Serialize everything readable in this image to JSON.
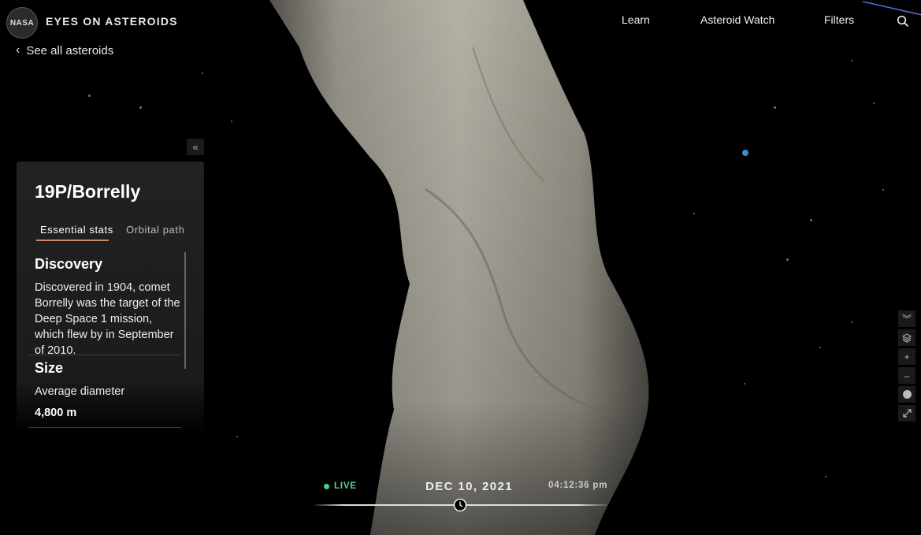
{
  "header": {
    "logo_text": "NASA",
    "app_title": "EYES ON ASTEROIDS",
    "back_link": "See all asteroids",
    "nav": {
      "learn": "Learn",
      "asteroid_watch": "Asteroid Watch",
      "filters": "Filters"
    }
  },
  "panel": {
    "title": "19P/Borrelly",
    "tabs": [
      {
        "label": "Essential stats",
        "active": true
      },
      {
        "label": "Orbital path",
        "active": false
      }
    ],
    "discovery": {
      "heading": "Discovery",
      "text": "Discovered in 1904, comet Borrelly was the target of the Deep Space 1 mission, which flew by in September of 2010."
    },
    "size": {
      "heading": "Size",
      "label": "Average diameter",
      "value": "4,800 m"
    }
  },
  "timeline": {
    "live_label": "LIVE",
    "date": "DEC 10, 2021",
    "time": "04:12:36 pm"
  },
  "colors": {
    "accent_underline": "#c98d6a",
    "live_green": "#4bd18a",
    "star_blue": "#3a7fb0"
  },
  "icons": [
    "nasa-logo",
    "chevron-left-icon",
    "search-icon",
    "double-chevron-left-icon",
    "double-chevron-down-icon",
    "layers-icon",
    "zoom-in-icon",
    "zoom-out-icon",
    "circle-icon",
    "expand-icon",
    "clock-icon"
  ]
}
